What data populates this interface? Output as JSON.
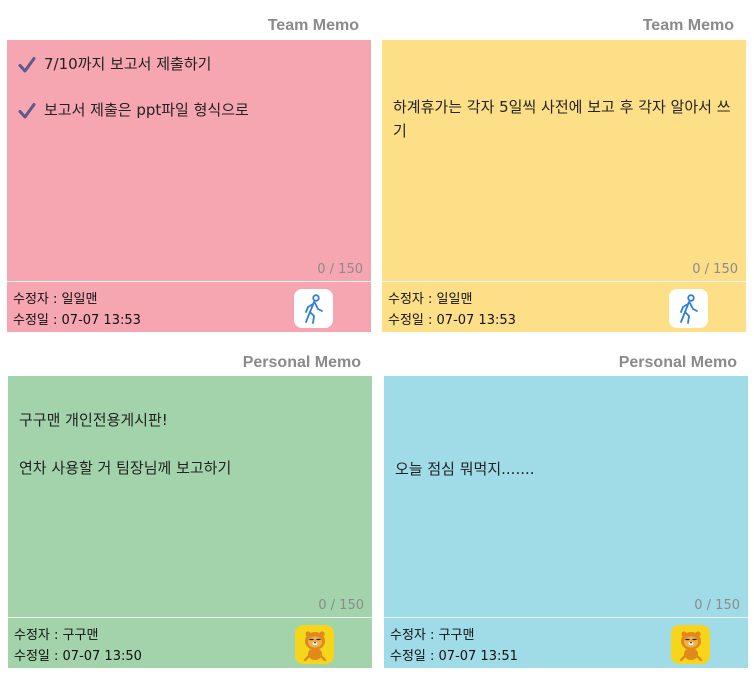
{
  "memos": [
    {
      "header": "Team Memo",
      "color": "#f6a6b0",
      "lines": [
        {
          "checked": true,
          "text": "7/10까지 보고서 제출하기"
        },
        {
          "checked": true,
          "text": "보고서 제출은 ppt파일 형식으로"
        }
      ],
      "counter": "0 / 150",
      "editor": "수정자 : 일일맨",
      "edited": "수정일 : 07-07 13:53",
      "avatar_icon": "walking-person-icon"
    },
    {
      "header": "Team Memo",
      "color": "#fddf88",
      "text": "하계휴가는 각자 5일씩 사전에 보고 후 각자 알아서 쓰기",
      "counter": "0 / 150",
      "editor": "수정자 : 일일맨",
      "edited": "수정일 : 07-07 13:53",
      "avatar_icon": "walking-person-icon"
    },
    {
      "header": "Personal Memo",
      "color": "#a3d3ab",
      "lines": [
        {
          "text": "구구맨 개인전용게시판!"
        },
        {
          "text": "연차 사용할 거 팀장님께 보고하기"
        }
      ],
      "counter": "0 / 150",
      "editor": "수정자 : 구구맨",
      "edited": "수정일 : 07-07 13:50",
      "avatar_icon": "lion-character-icon"
    },
    {
      "header": "Personal Memo",
      "color": "#a0dce8",
      "text": "오늘 점심 뭐먹지.......",
      "counter": "0 / 150",
      "editor": "수정자 : 구구맨",
      "edited": "수정일 : 07-07 13:51",
      "avatar_icon": "lion-character-icon"
    }
  ]
}
